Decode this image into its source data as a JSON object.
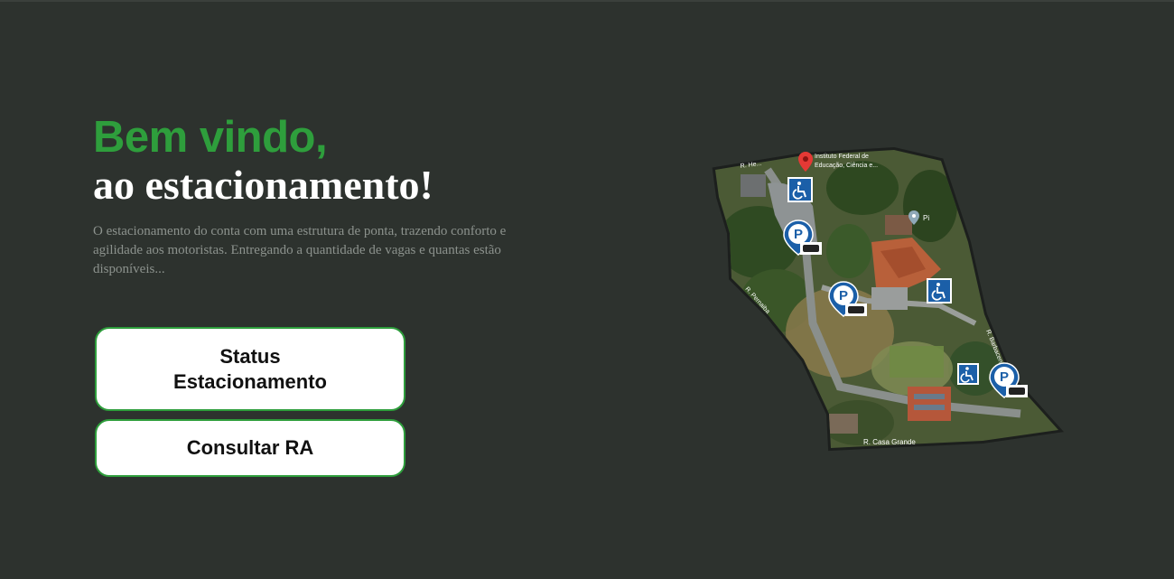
{
  "hero": {
    "title_line1": "Bem vindo,",
    "title_line2": "ao estacionamento!",
    "description": "O estacionamento do conta com uma estrutura de ponta, trazendo conforto e agilidade aos motoristas. Entregando a quantidade de vagas e quantas estão disponíveis..."
  },
  "buttons": {
    "status_label": "Status Estacionamento",
    "consult_label": "Consultar RA"
  },
  "map": {
    "marker_label_line1": "Instituto Federal de",
    "marker_label_line2": "Educação, Ciência e...",
    "street_top": "R. He...",
    "street_left": "R. Pernaiba",
    "street_right": "R. Barbacena",
    "street_bottom": "R. Casa Grande",
    "poi_label": "Pi",
    "parking_symbol": "P",
    "accessible_icon": "wheelchair-icon",
    "parking_icon": "parking-pin-icon",
    "location_icon": "location-pin-icon"
  },
  "colors": {
    "background": "#2d322e",
    "accent_green": "#2e9e3c",
    "parking_blue": "#1b5fa8",
    "pin_red": "#e53935"
  }
}
